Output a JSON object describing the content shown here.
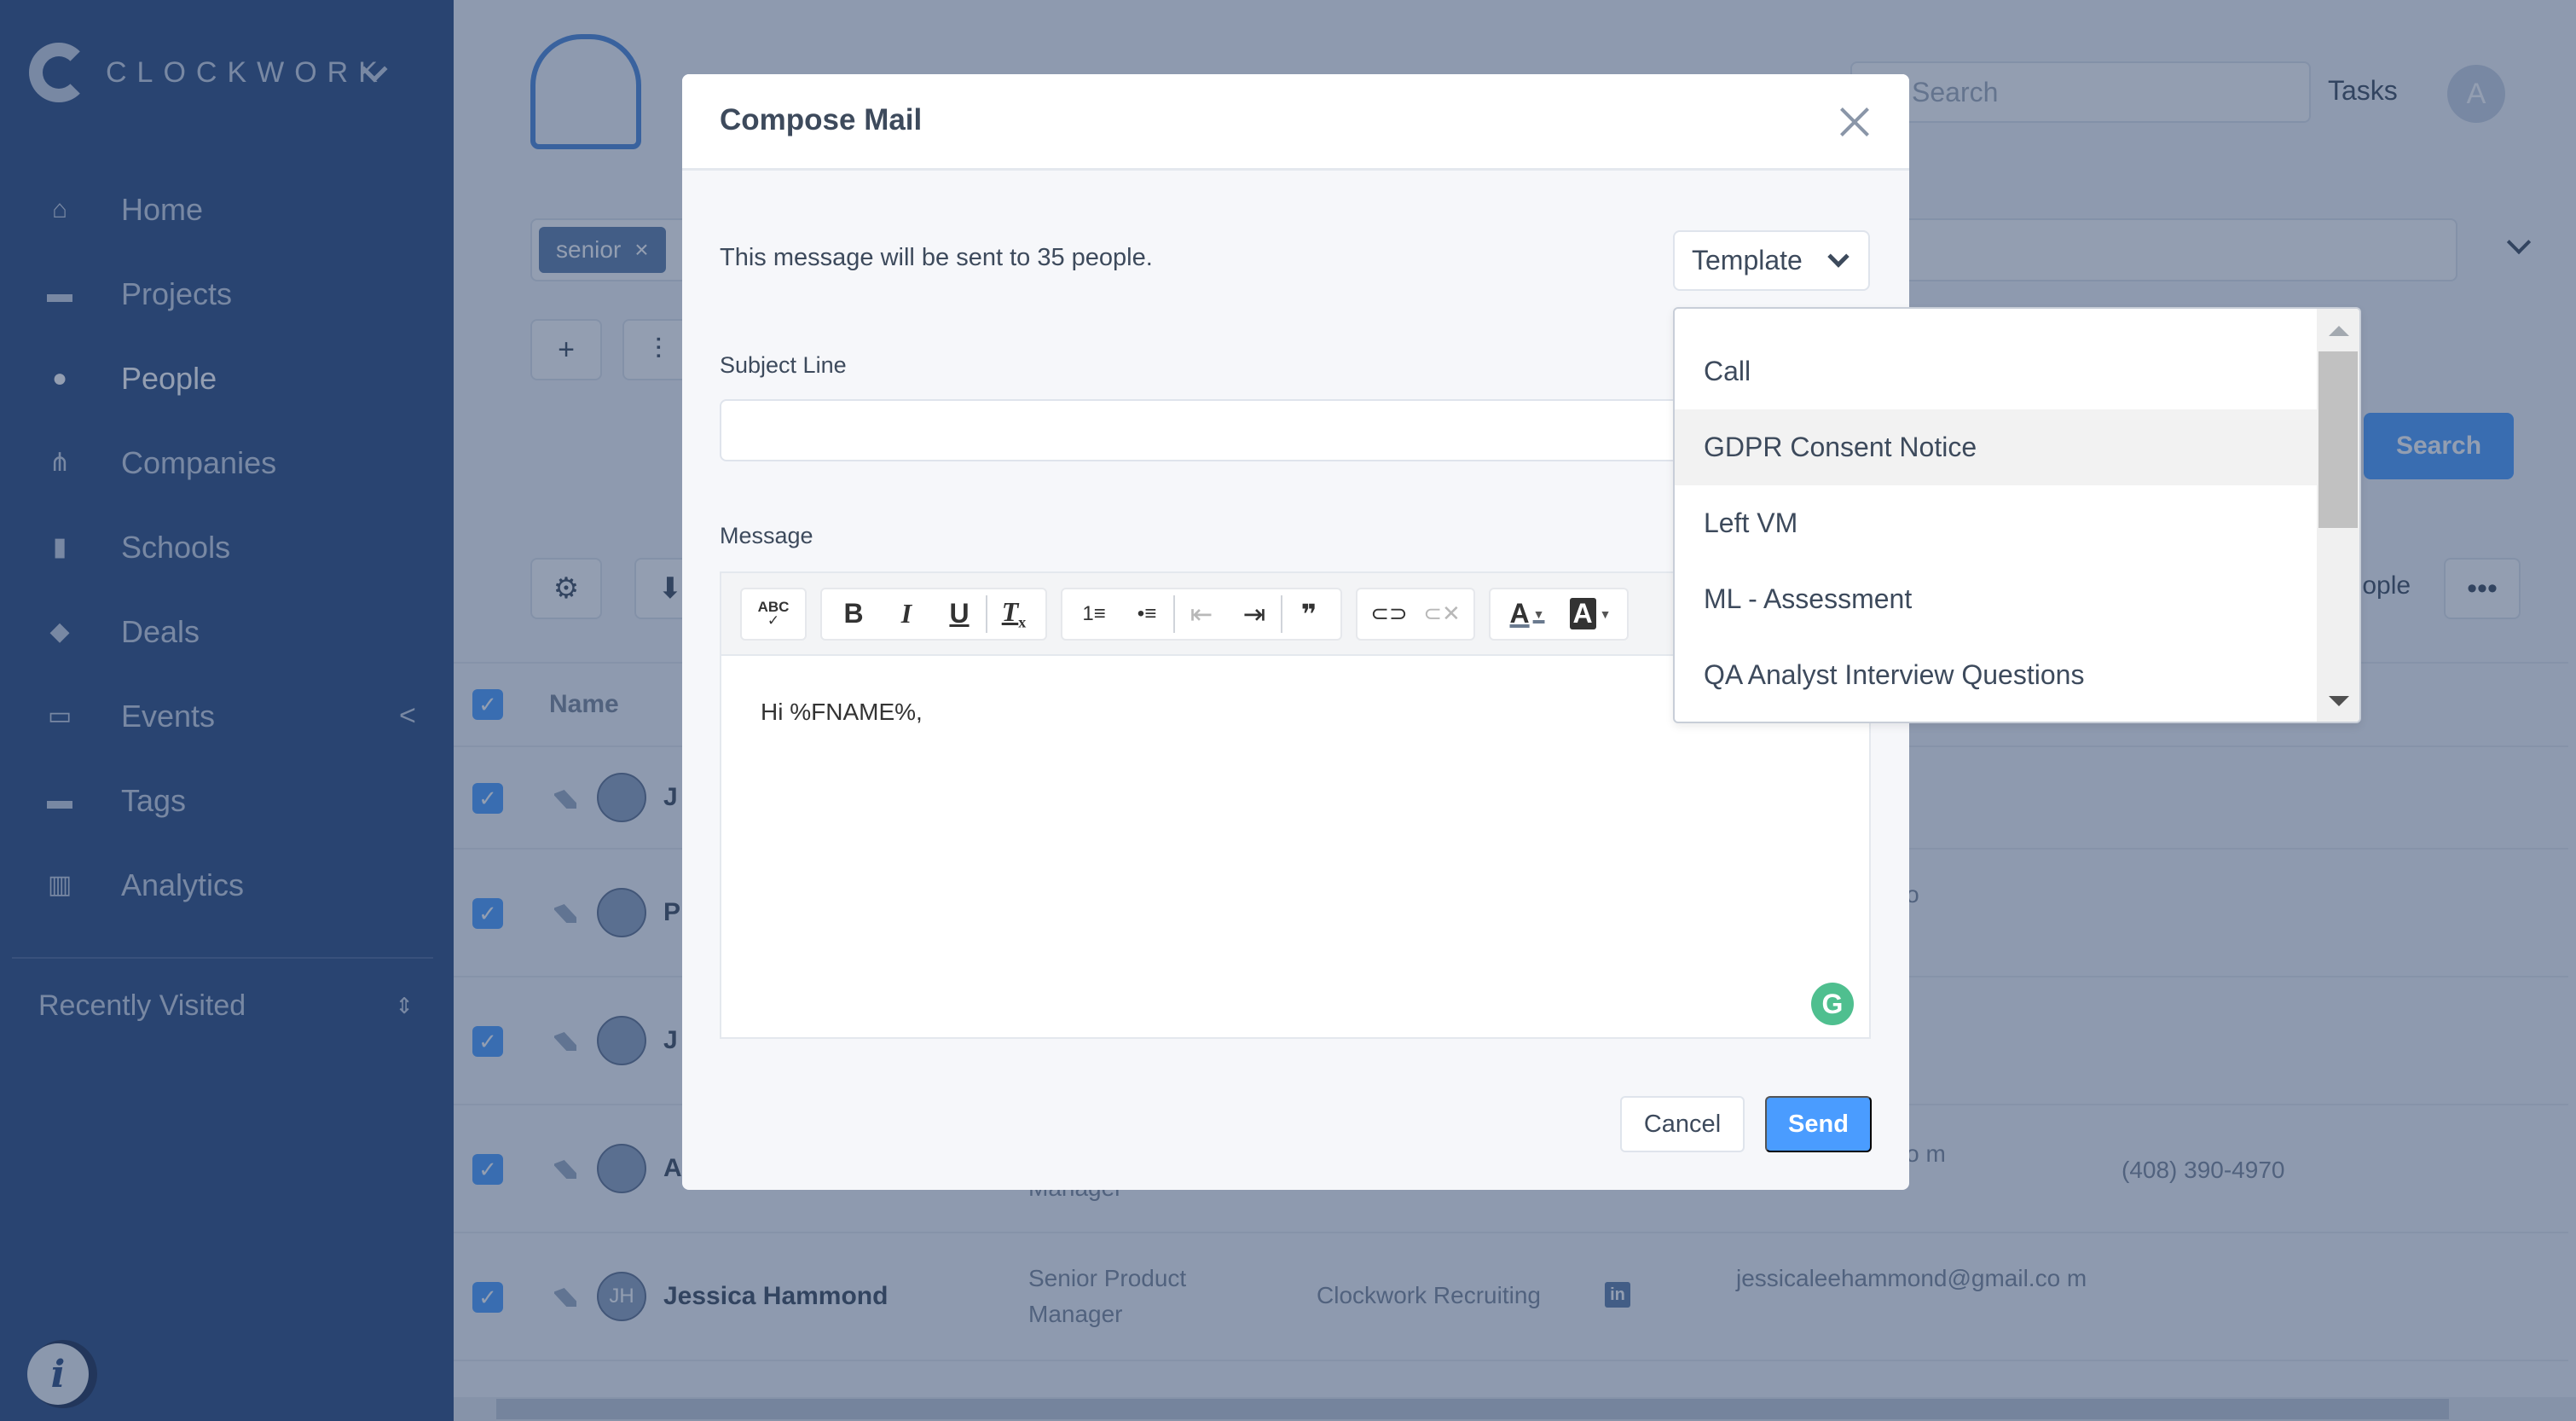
{
  "app": {
    "brand": "CLOCKWORK",
    "sidebar": {
      "items": [
        {
          "label": "Home",
          "icon": "home-icon",
          "active": false
        },
        {
          "label": "Projects",
          "icon": "briefcase-icon",
          "active": false
        },
        {
          "label": "People",
          "icon": "person-icon",
          "active": true
        },
        {
          "label": "Companies",
          "icon": "org-chart-icon",
          "active": false
        },
        {
          "label": "Schools",
          "icon": "book-icon",
          "active": false
        },
        {
          "label": "Deals",
          "icon": "tag-icon",
          "active": false
        },
        {
          "label": "Events",
          "icon": "calendar-icon",
          "active": false
        },
        {
          "label": "Tags",
          "icon": "label-icon",
          "active": false
        },
        {
          "label": "Analytics",
          "icon": "bar-chart-icon",
          "active": false
        }
      ],
      "events_caret": "<",
      "recently_visited": "Recently Visited",
      "info_button": "i"
    },
    "header": {
      "search_placeholder": "Search",
      "tasks_label": "Tasks",
      "avatar_initial": "A"
    },
    "filter": {
      "chip_label": "senior",
      "chip_remove": "×"
    },
    "toolbar": {
      "add": "+",
      "filters": "⚙",
      "search_button": "Search",
      "people_label": "people",
      "more": "•••"
    },
    "table": {
      "name_header": "Name",
      "rows": [
        {
          "initials": "",
          "name": "J",
          "title": "",
          "company": "",
          "email": "",
          "phone": ""
        },
        {
          "initials": "",
          "name": "P",
          "title": "",
          "company": "",
          "email": "...orkrecruiting.co",
          "phone": ""
        },
        {
          "initials": "",
          "name": "J",
          "title": "",
          "company": "",
          "email": "",
          "phone": ""
        },
        {
          "initials": "",
          "name": "A",
          "title": "Manager",
          "company": "",
          "email": "...orkrecruiting.co m",
          "phone": "(408) 390-4970"
        },
        {
          "initials": "JH",
          "name": "Jessica Hammond",
          "title": "Senior Product Manager",
          "company": "Clockwork Recruiting",
          "email": "jessicaleehammond@gmail.co m",
          "phone": ""
        }
      ]
    }
  },
  "modal": {
    "title": "Compose Mail",
    "recipients_text": "This message will be sent to 35 people.",
    "template_button": "Template",
    "subject_label": "Subject Line",
    "subject_value": "",
    "message_label": "Message",
    "message_body": "Hi %FNAME%,",
    "toolbar": {
      "spellcheck": "ABC",
      "bold": "B",
      "italic": "I",
      "underline": "U",
      "clear_format": "Tx",
      "ordered_list": "1≡",
      "bullet_list": "•≡",
      "outdent": "⇤",
      "indent": "⇥",
      "blockquote": "❞",
      "link": "🔗",
      "unlink": "⛓",
      "font_color": "A",
      "bg_color": "A"
    },
    "grammarly": "G",
    "cancel_button": "Cancel",
    "send_button": "Send"
  },
  "template_dropdown": {
    "items": [
      {
        "label": "Call",
        "hover": false
      },
      {
        "label": "GDPR Consent Notice",
        "hover": true
      },
      {
        "label": "Left VM",
        "hover": false
      },
      {
        "label": "ML - Assessment",
        "hover": false
      },
      {
        "label": "QA Analyst Interview Questions",
        "hover": false
      }
    ]
  },
  "colors": {
    "accent": "#4a9cff",
    "sidebar": "#2b4a7f",
    "grammarly": "#4fbf8f"
  }
}
